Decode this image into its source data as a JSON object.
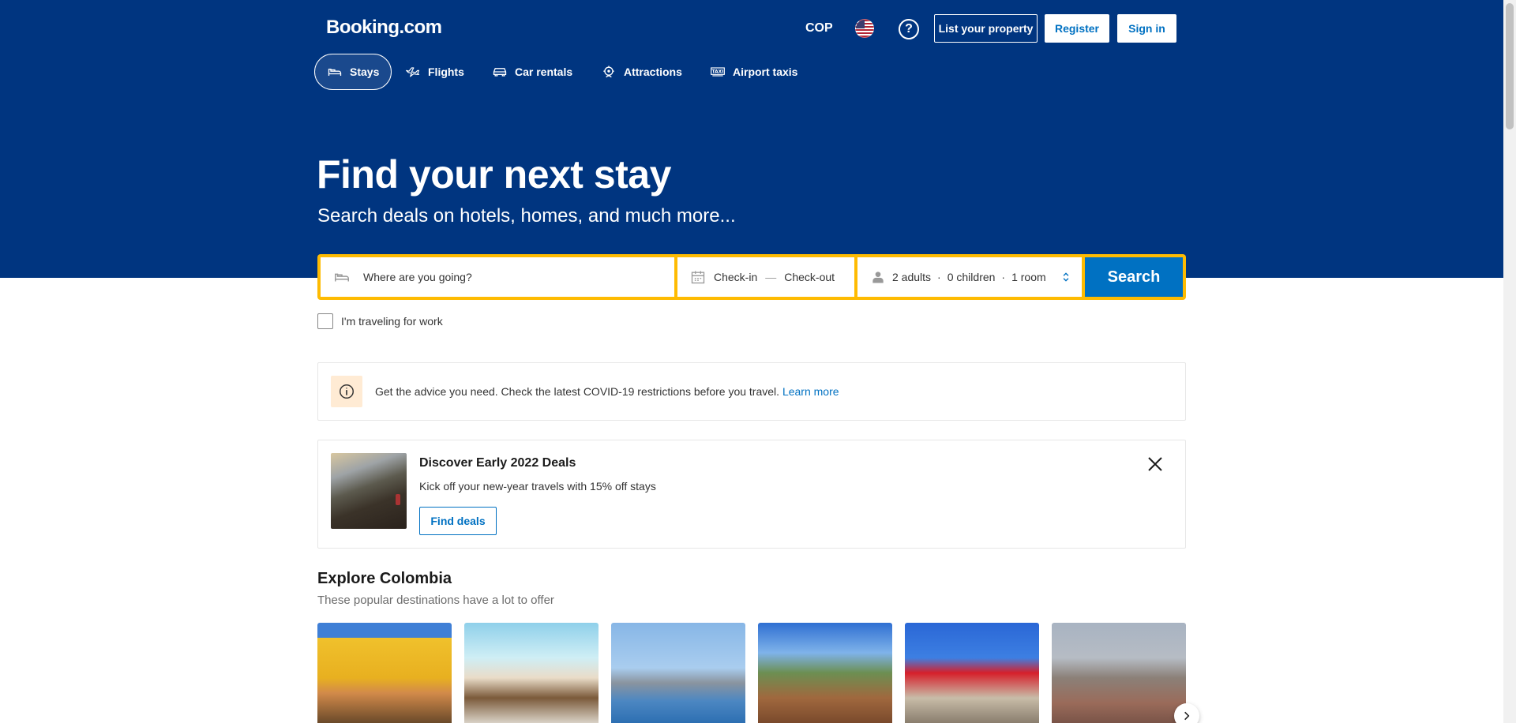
{
  "header": {
    "logo": "Booking.com",
    "currency": "COP",
    "list_property": "List your property",
    "register": "Register",
    "sign_in": "Sign in"
  },
  "nav": {
    "tabs": [
      {
        "label": "Stays",
        "icon": "bed-icon",
        "active": true
      },
      {
        "label": "Flights",
        "icon": "plane-icon"
      },
      {
        "label": "Car rentals",
        "icon": "car-icon"
      },
      {
        "label": "Attractions",
        "icon": "attractions-icon"
      },
      {
        "label": "Airport taxis",
        "icon": "taxi-icon"
      }
    ]
  },
  "hero": {
    "title": "Find your next stay",
    "subtitle": "Search deals on hotels, homes, and much more..."
  },
  "search": {
    "destination_placeholder": "Where are you going?",
    "check_in": "Check-in",
    "dash": "—",
    "check_out": "Check-out",
    "adults": "2 adults",
    "children": "0 children",
    "rooms": "1 room",
    "sep": "·",
    "button": "Search",
    "work_travel": "I'm traveling for work"
  },
  "covid_banner": {
    "text": "Get the advice you need. Check the latest COVID-19 restrictions before you travel.",
    "link": "Learn more"
  },
  "deal_banner": {
    "title": "Discover Early 2022 Deals",
    "text": "Kick off your new-year travels with 15% off stays",
    "button": "Find deals"
  },
  "explore": {
    "title": "Explore Colombia",
    "subtitle": "These popular destinations have a lot to offer"
  },
  "colors": {
    "brand_blue": "#003580",
    "accent_yellow": "#febb02",
    "action_blue": "#0071c2"
  }
}
